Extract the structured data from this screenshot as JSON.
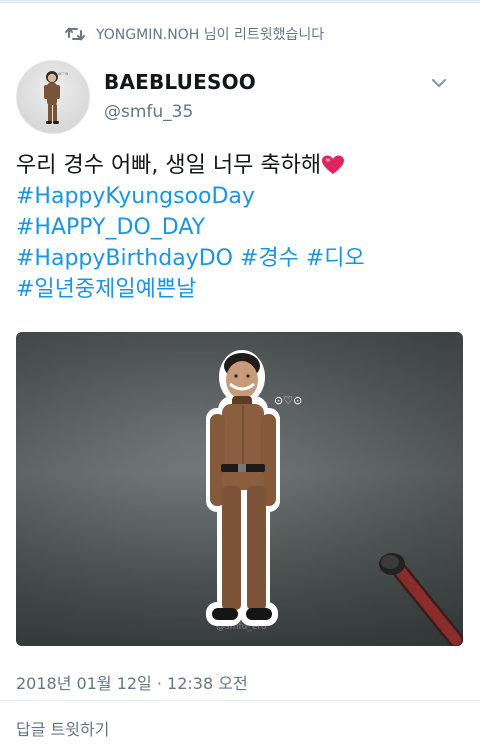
{
  "retweet": {
    "icon": "retweet-icon",
    "text": "YONGMIN.NOH 님이 리트윗했습니다"
  },
  "author": {
    "display_name": "BAEBLUESOO",
    "handle": "@smfu_35",
    "avatar": "avatar-image"
  },
  "tweet": {
    "line1_text": "우리 경수 어빠, 생일 너무 축하해",
    "line1_emoji": "red-heart-emoji",
    "hashtags": {
      "happy_kyungsoo_day": "#HappyKyungsooDay",
      "happy_do_day": "#HAPPY_DO_DAY",
      "happy_birthday_do": "#HappyBirthdayDO",
      "kyungsoo": "#경수",
      "dio": "#디오",
      "prettiest_day": "#일년중제일예쁜날"
    }
  },
  "media": {
    "type": "photo",
    "sticker_text": "⊙♡⊙",
    "watermark": "@smfu_ero"
  },
  "meta": {
    "timestamp": "2018년 01월 12일 · 12:38 오전"
  },
  "actions": {
    "reply_label": "답글 트윗하기"
  },
  "colors": {
    "accent": "#1b95e0",
    "secondary_text": "#657786",
    "primary_text": "#14171a",
    "heart": "#e0245e"
  }
}
